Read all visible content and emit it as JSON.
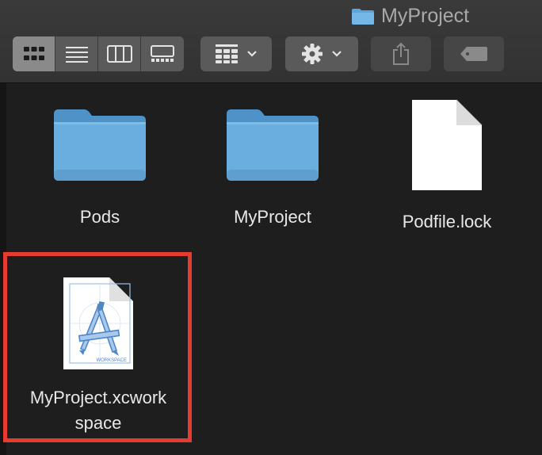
{
  "window": {
    "title": "MyProject",
    "title_icon": "folder-icon"
  },
  "toolbar": {
    "view_modes": [
      {
        "name": "icon-view",
        "icon": "grid-icon",
        "active": true
      },
      {
        "name": "list-view",
        "icon": "list-icon",
        "active": false
      },
      {
        "name": "column-view",
        "icon": "columns-icon",
        "active": false
      },
      {
        "name": "gallery-view",
        "icon": "gallery-icon",
        "active": false
      }
    ],
    "group_button_icon": "group-grid-icon",
    "action_button_icon": "gear-icon",
    "share_button_icon": "share-icon",
    "tag_button_icon": "tag-icon"
  },
  "files": [
    {
      "label": "Pods",
      "type": "folder"
    },
    {
      "label": "MyProject",
      "type": "folder"
    },
    {
      "label": "Podfile.lock",
      "type": "document"
    },
    {
      "label_line1": "MyProject.xcwork",
      "label_line2": "space",
      "type": "xcworkspace",
      "icon_caption": "WORKSPACE",
      "highlighted": true
    }
  ],
  "colors": {
    "background": "#1e1e1e",
    "folder": "#6aaee0",
    "highlight_border": "#e63b2e"
  }
}
